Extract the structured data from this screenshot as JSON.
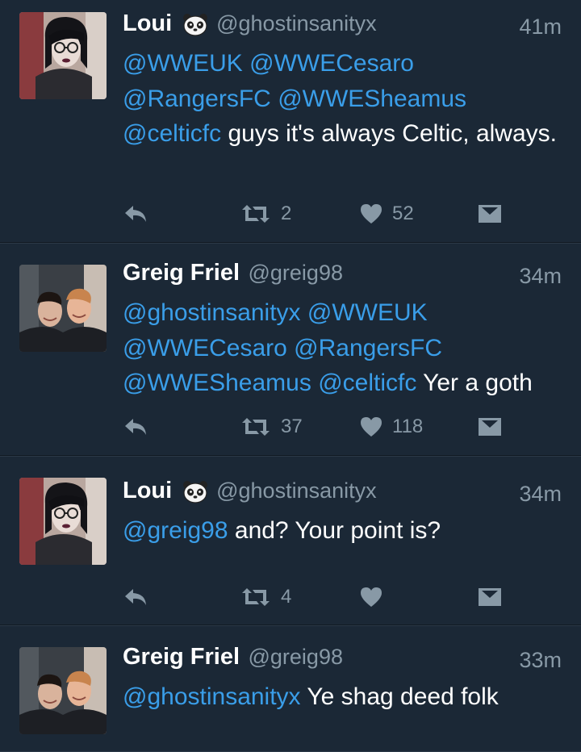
{
  "tweets": [
    {
      "name": "Loui",
      "emoji": "panda-face-icon",
      "handle": "@ghostinsanityx",
      "time": "41m",
      "body": [
        {
          "text": "@WWEUK",
          "mention": true
        },
        {
          "text": " ",
          "mention": false
        },
        {
          "text": "@WWECesaro",
          "mention": true
        },
        {
          "text": " ",
          "mention": false
        },
        {
          "text": "@RangersFC",
          "mention": true
        },
        {
          "text": " ",
          "mention": false
        },
        {
          "text": "@WWESheamus",
          "mention": true
        },
        {
          "text": " ",
          "mention": false
        },
        {
          "text": "@celticfc",
          "mention": true
        },
        {
          "text": " guys it's always Celtic, always.",
          "mention": false
        }
      ],
      "actions": {
        "retweets": "2",
        "likes": "52"
      }
    },
    {
      "name": "Greig Friel",
      "handle": "@greig98",
      "time": "34m",
      "body": [
        {
          "text": "@ghostinsanityx",
          "mention": true
        },
        {
          "text": " ",
          "mention": false
        },
        {
          "text": "@WWEUK",
          "mention": true
        },
        {
          "text": " ",
          "mention": false
        },
        {
          "text": "@WWECesaro",
          "mention": true
        },
        {
          "text": " ",
          "mention": false
        },
        {
          "text": "@RangersFC",
          "mention": true
        },
        {
          "text": " ",
          "mention": false
        },
        {
          "text": "@WWESheamus",
          "mention": true
        },
        {
          "text": " ",
          "mention": false
        },
        {
          "text": "@celticfc",
          "mention": true
        },
        {
          "text": " Yer a goth",
          "mention": false
        }
      ],
      "actions": {
        "retweets": "37",
        "likes": "118"
      }
    },
    {
      "name": "Loui",
      "emoji": "panda-face-icon",
      "handle": "@ghostinsanityx",
      "time": "34m",
      "body": [
        {
          "text": "@greig98",
          "mention": true
        },
        {
          "text": " and? Your point is?",
          "mention": false
        }
      ],
      "actions": {
        "retweets": "4",
        "likes": ""
      }
    },
    {
      "name": "Greig Friel",
      "handle": "@greig98",
      "time": "33m",
      "body": [
        {
          "text": "@ghostinsanityx",
          "mention": true
        },
        {
          "text": " Ye shag deed folk",
          "mention": false
        }
      ]
    }
  ],
  "colors": {
    "background": "#1b2836",
    "mention": "#3a9ee9",
    "secondary_text": "#8899a6",
    "divider": "#111a23"
  },
  "icons": {
    "reply": "reply-icon",
    "retweet": "retweet-icon",
    "like": "heart-icon",
    "dm": "direct-message-icon"
  }
}
